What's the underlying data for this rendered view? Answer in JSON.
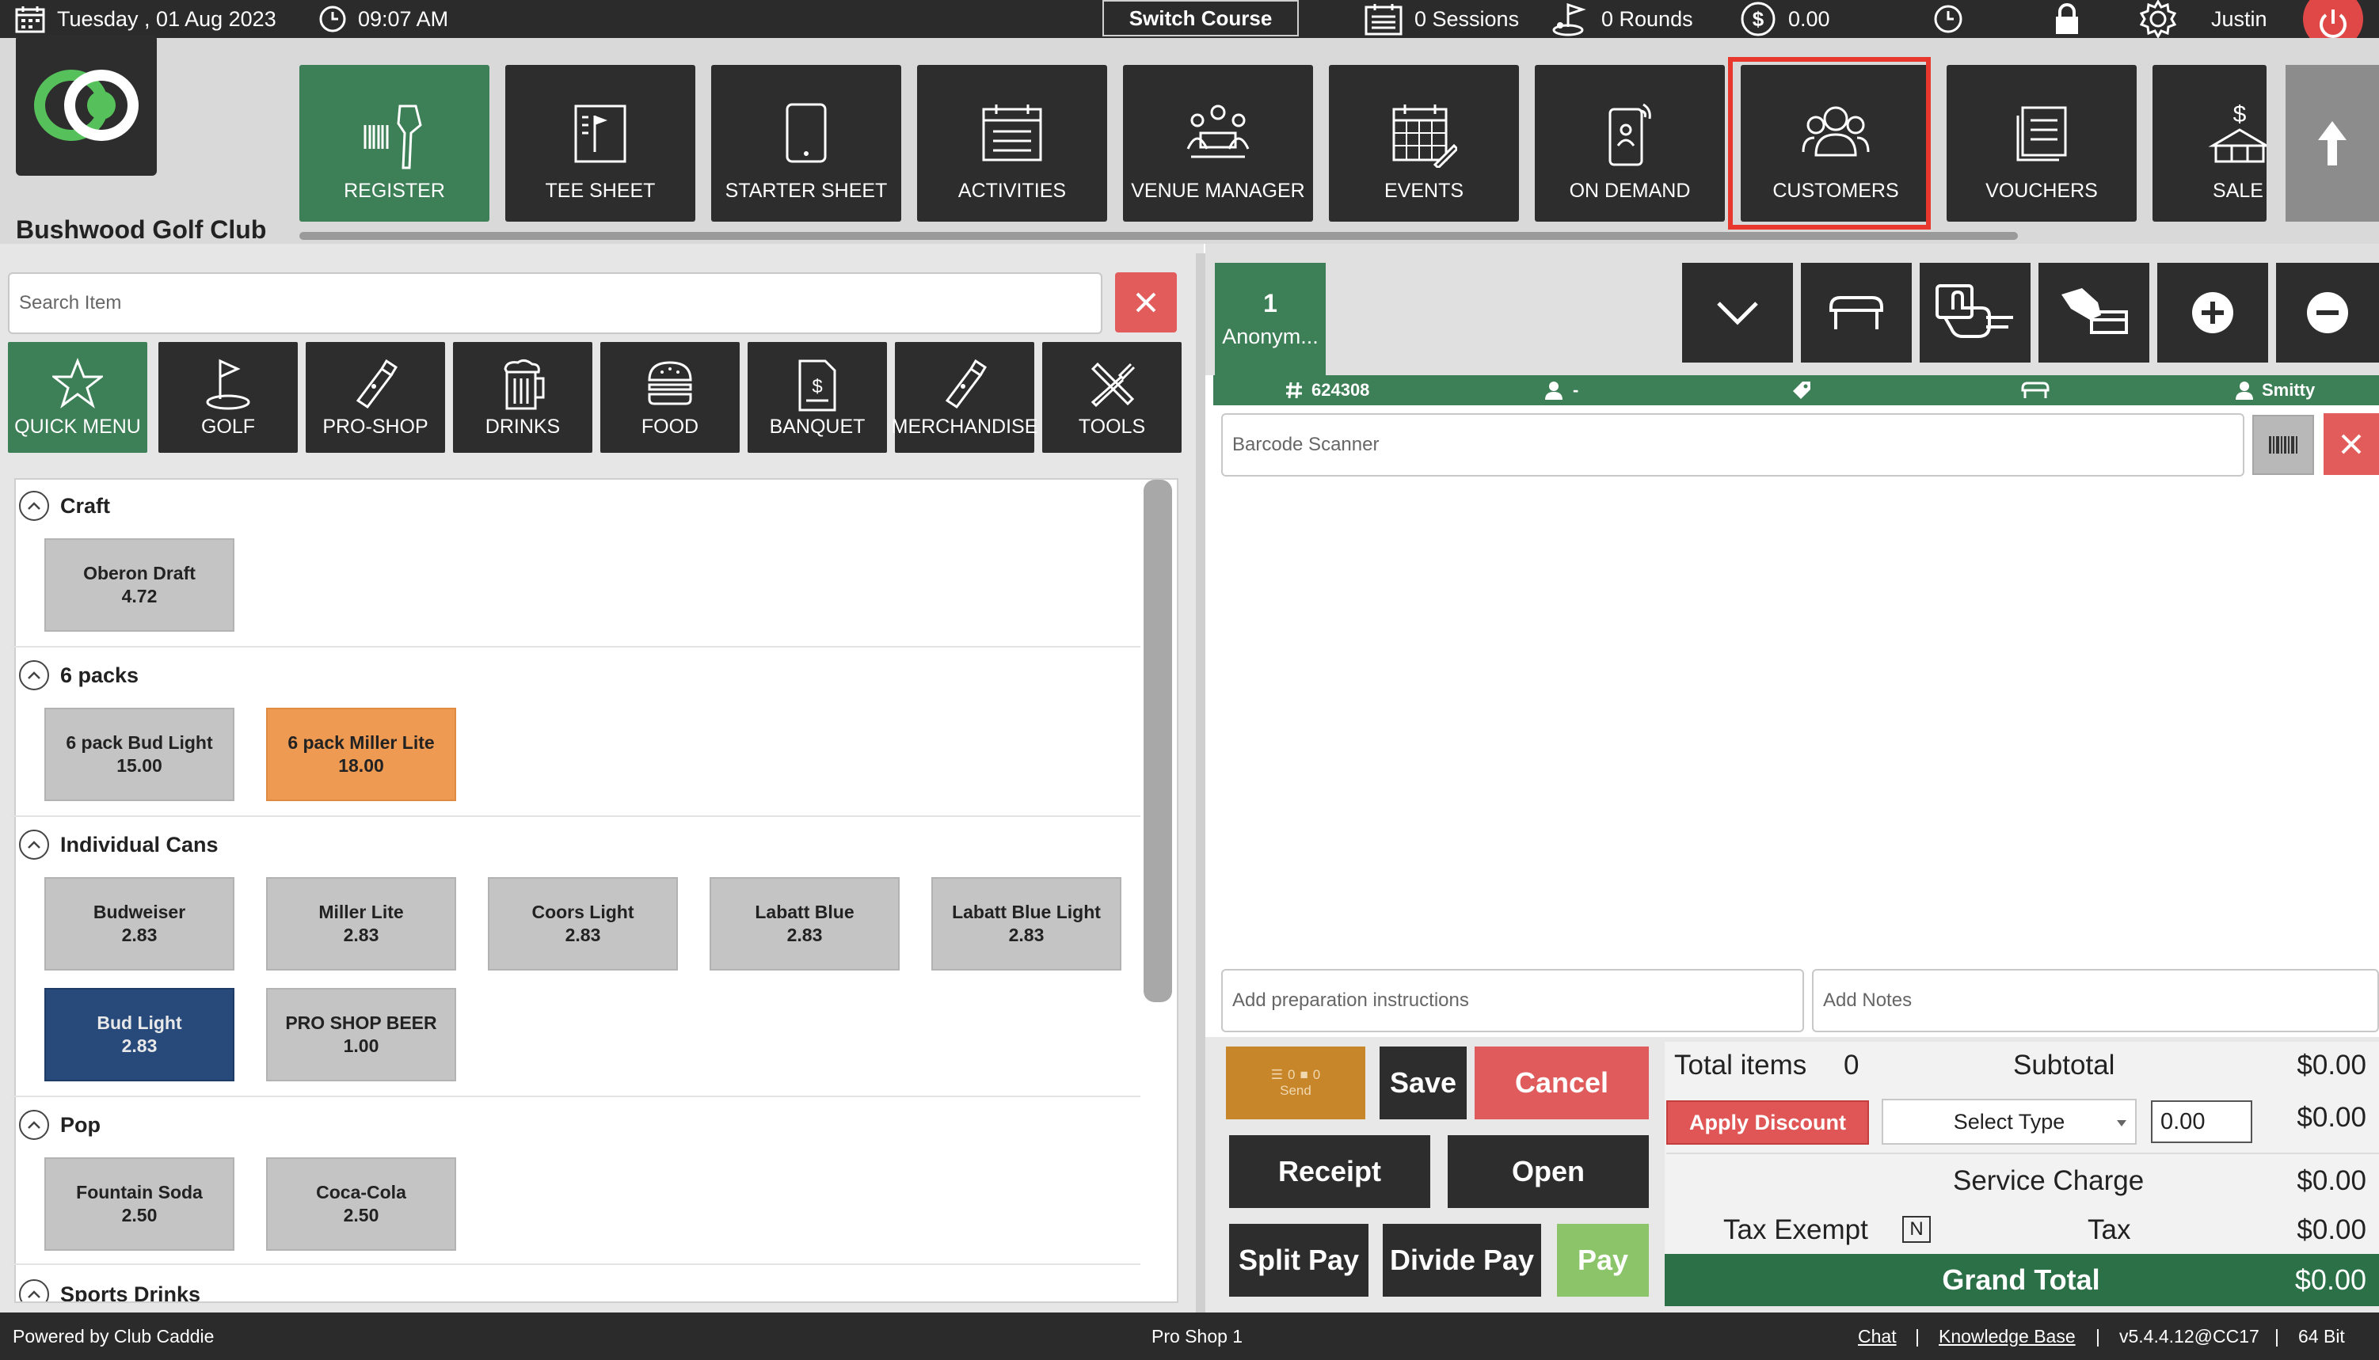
{
  "topbar": {
    "date": "Tuesday ,  01 Aug 2023",
    "time": "09:07 AM",
    "switch_course": "Switch Course",
    "sessions": "0 Sessions",
    "rounds": "0 Rounds",
    "balance": "0.00",
    "user": "Justin"
  },
  "club": {
    "name": "Bushwood Golf Club"
  },
  "nav": {
    "items": [
      {
        "label": "REGISTER",
        "icon": "barcode-scanner-icon"
      },
      {
        "label": "TEE SHEET",
        "icon": "tee-sheet-icon"
      },
      {
        "label": "STARTER SHEET",
        "icon": "tablet-icon"
      },
      {
        "label": "ACTIVITIES",
        "icon": "calendar-list-icon"
      },
      {
        "label": "VENUE MANAGER",
        "icon": "venue-meeting-icon"
      },
      {
        "label": "EVENTS",
        "icon": "events-calendar-icon"
      },
      {
        "label": "ON DEMAND",
        "icon": "mobile-ordering-icon"
      },
      {
        "label": "CUSTOMERS",
        "icon": "customers-group-icon"
      },
      {
        "label": "VOUCHERS",
        "icon": "vouchers-icon"
      },
      {
        "label": "SALE",
        "icon": "sale-icon"
      }
    ],
    "active": "REGISTER",
    "highlighted": "CUSTOMERS"
  },
  "search": {
    "placeholder": "Search Item"
  },
  "categories": [
    {
      "label": "QUICK MENU",
      "icon": "star-icon"
    },
    {
      "label": "GOLF",
      "icon": "golf-flag-icon"
    },
    {
      "label": "PRO-SHOP",
      "icon": "pro-shop-icon"
    },
    {
      "label": "DRINKS",
      "icon": "beer-mug-icon"
    },
    {
      "label": "FOOD",
      "icon": "burger-icon"
    },
    {
      "label": "BANQUET",
      "icon": "banquet-document-icon"
    },
    {
      "label": "MERCHANDISE",
      "icon": "merchandise-icon"
    },
    {
      "label": "TOOLS",
      "icon": "tools-icon"
    }
  ],
  "menu": {
    "sections": [
      {
        "title": "Craft",
        "items": [
          {
            "name": "Oberon Draft",
            "price": "4.72"
          }
        ]
      },
      {
        "title": "6 packs",
        "items": [
          {
            "name": "6 pack Bud Light",
            "price": "15.00"
          },
          {
            "name": "6 pack Miller Lite",
            "price": "18.00"
          }
        ]
      },
      {
        "title": "Individual Cans",
        "items": [
          {
            "name": "Budweiser",
            "price": "2.83"
          },
          {
            "name": "Miller Lite",
            "price": "2.83"
          },
          {
            "name": "Coors Light",
            "price": "2.83"
          },
          {
            "name": "Labatt Blue",
            "price": "2.83"
          },
          {
            "name": "Labatt Blue Light",
            "price": "2.83"
          },
          {
            "name": "Bud Light",
            "price": "2.83"
          },
          {
            "name": "PRO SHOP BEER",
            "price": "1.00"
          }
        ]
      },
      {
        "title": "Pop",
        "items": [
          {
            "name": "Fountain Soda",
            "price": "2.50"
          },
          {
            "name": "Coca-Cola",
            "price": "2.50"
          }
        ]
      },
      {
        "title": "Sports Drinks",
        "items": []
      }
    ]
  },
  "ticket": {
    "tab_number": "1",
    "tab_name": "Anonym...",
    "order_number": "624308",
    "customer": "-",
    "server": "Smitty",
    "barcode_placeholder": "Barcode Scanner",
    "prep_placeholder": "Add preparation instructions",
    "notes_placeholder": "Add Notes"
  },
  "actions": {
    "send_label": "Send",
    "send_counts": [
      "0",
      "0"
    ],
    "save": "Save",
    "cancel": "Cancel",
    "receipt": "Receipt",
    "open": "Open",
    "split_pay": "Split Pay",
    "divide_pay": "Divide Pay",
    "pay": "Pay"
  },
  "totals": {
    "total_items_label": "Total items",
    "total_items": "0",
    "subtotal_label": "Subtotal",
    "subtotal": "$0.00",
    "apply_discount": "Apply Discount",
    "select_type": "Select Type",
    "discount_value": "0.00",
    "discount_amount": "$0.00",
    "service_charge_label": "Service Charge",
    "service_charge": "$0.00",
    "tax_exempt_label": "Tax Exempt",
    "tax_exempt_flag": "N",
    "tax_label": "Tax",
    "tax": "$0.00",
    "grand_total_label": "Grand Total",
    "grand_total": "$0.00"
  },
  "footer": {
    "powered_by": "Powered by Club Caddie",
    "location": "Pro Shop 1",
    "chat": "Chat",
    "knowledge_base": "Knowledge Base",
    "version": "v5.4.4.12@CC17",
    "arch": "64 Bit",
    "separator": "|"
  },
  "colors": {
    "accent_green": "#3d7f56",
    "grand_total_green": "#2c7048",
    "danger_red": "#e25c5c",
    "highlight_red": "#e8382e",
    "dark_button": "#2d2d2d"
  }
}
